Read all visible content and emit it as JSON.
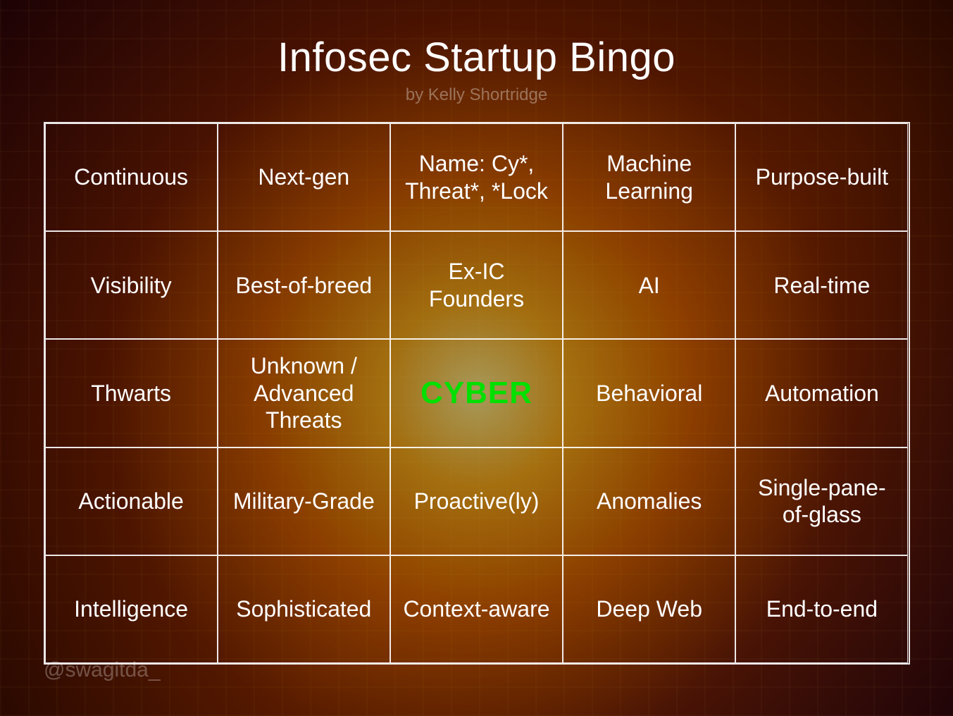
{
  "title": "Infosec Startup Bingo",
  "subtitle": "by Kelly Shortridge",
  "handle": "@swagitda_",
  "free_square_index": 12,
  "cells": [
    "Continuous",
    "Next-gen",
    "Name: Cy*, Threat*, *Lock",
    "Machine Learning",
    "Purpose-built",
    "Visibility",
    "Best-of-breed",
    "Ex-IC Founders",
    "AI",
    "Real-time",
    "Thwarts",
    "Unknown / Advanced Threats",
    "CYBER",
    "Behavioral",
    "Automation",
    "Actionable",
    "Military-Grade",
    "Proactive(ly)",
    "Anomalies",
    "Single-pane-of-glass",
    "Intelligence",
    "Sophisticated",
    "Context-aware",
    "Deep Web",
    "End-to-end"
  ]
}
